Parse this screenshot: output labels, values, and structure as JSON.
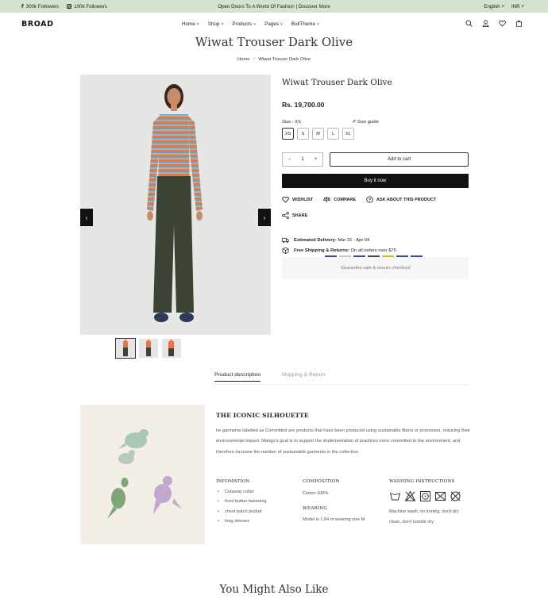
{
  "topbar": {
    "facebook": "300k Followers",
    "instagram": "100k Followers",
    "announcement": "Open Doors To A World Of Fashion | Discover More",
    "language": "English",
    "currency": "INR"
  },
  "header": {
    "logo": "BROAD",
    "nav": [
      "Home",
      "Shop",
      "Products",
      "Pages",
      "BullTheme"
    ],
    "icons": [
      "search-icon",
      "user-icon",
      "heart-icon",
      "bag-icon"
    ]
  },
  "page": {
    "title": "Wiwat Trouser Dark Olive",
    "breadcrumb_home": "Home",
    "breadcrumb_sep": "/",
    "breadcrumb_current": "Wiwat Trouser Dark Olive"
  },
  "product": {
    "name": "Wiwat Trouser Dark Olive",
    "price": "Rs. 19,700.00",
    "size_label": "Size : XS",
    "size_guide": "Size guide",
    "sizes": [
      "XS",
      "S",
      "M",
      "L",
      "XL"
    ],
    "quantity": "1",
    "qty_minus": "−",
    "qty_plus": "+",
    "add_to_cart": "Add to cart",
    "buy_now": "Buy it now",
    "wishlist": "WISHLIST",
    "compare": "COMPARE",
    "ask": "ASK ABOUT THIS PRODUCT",
    "share": "SHARE",
    "delivery_label": "Estimated Delivery:",
    "delivery_value": "Mar 31 - Apr 04",
    "shipping_label": "Free Shipping & Returns:",
    "shipping_value": "On all orders over $75",
    "checkout_note": "Guarantee safe & secure checkout"
  },
  "tabs": {
    "description": "Product description",
    "shipping": "Shipping & Return"
  },
  "description": {
    "heading": "THE ICONIC SILHOUETTE",
    "body": "he garments labelled as Committed are products that have been produced using sustainable fibers or processes, reducing their environmental impact. Mango's goal is to support the implementation of practices more committed to the environment, and therefore increase the number of sustainable garments in the collection.",
    "info_heading": "INFOMATION",
    "info_items": [
      "Cutaway collar",
      "front button fastening",
      "chest patch pocket",
      "long sleeves"
    ],
    "composition_heading": "COMPOSITION",
    "composition": "Cotton 100%",
    "wearing_heading": "WEARING",
    "wearing": "Model is 1.84 m wearing size M",
    "washing_heading": "WASHING INSTRUCTIONS",
    "washing": "Machine wash, no ironing, don't dry clean, don't tumble dry"
  },
  "also_like": "You Might Also Like",
  "colors": {
    "topbar_bg": "#d6e2cd",
    "trouser": "#3b4434",
    "sweater_orange": "#e8744a",
    "sweater_blue": "#5fa8c8"
  }
}
